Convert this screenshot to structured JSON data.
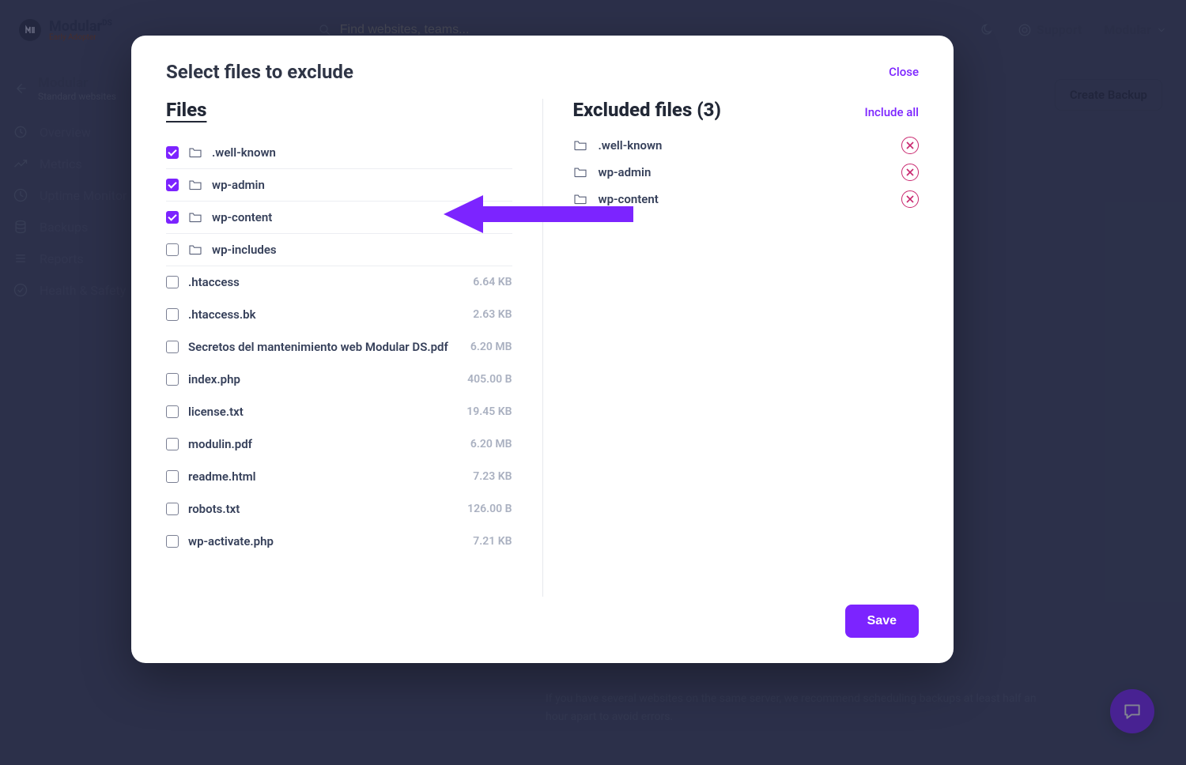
{
  "brand": {
    "name": "Modular",
    "suffix": "DS",
    "badge": "Early Adopter"
  },
  "search": {
    "placeholder": "Find websites, teams..."
  },
  "topbar": {
    "support": "Support",
    "user": "Modular"
  },
  "site": {
    "name": "Modular",
    "sub": "Standard websites"
  },
  "nav": {
    "items": [
      "Overview",
      "Metrics",
      "Uptime Monitor",
      "Backups",
      "Reports",
      "Health & Safety"
    ]
  },
  "buttons": {
    "create_backup": "Create Backup",
    "save": "Save"
  },
  "modal": {
    "title": "Select files to exclude",
    "close": "Close",
    "files_title": "Files",
    "excluded_title": "Excluded files (3)",
    "include_all": "Include all"
  },
  "files": [
    {
      "name": ".well-known",
      "folder": true,
      "checked": true,
      "size": ""
    },
    {
      "name": "wp-admin",
      "folder": true,
      "checked": true,
      "size": ""
    },
    {
      "name": "wp-content",
      "folder": true,
      "checked": true,
      "size": ""
    },
    {
      "name": "wp-includes",
      "folder": true,
      "checked": false,
      "size": ""
    },
    {
      "name": ".htaccess",
      "folder": false,
      "checked": false,
      "size": "6.64 KB"
    },
    {
      "name": ".htaccess.bk",
      "folder": false,
      "checked": false,
      "size": "2.63 KB"
    },
    {
      "name": "Secretos del mantenimiento web Modular DS.pdf",
      "folder": false,
      "checked": false,
      "size": "6.20 MB"
    },
    {
      "name": "index.php",
      "folder": false,
      "checked": false,
      "size": "405.00 B"
    },
    {
      "name": "license.txt",
      "folder": false,
      "checked": false,
      "size": "19.45 KB"
    },
    {
      "name": "modulin.pdf",
      "folder": false,
      "checked": false,
      "size": "6.20 MB"
    },
    {
      "name": "readme.html",
      "folder": false,
      "checked": false,
      "size": "7.23 KB"
    },
    {
      "name": "robots.txt",
      "folder": false,
      "checked": false,
      "size": "126.00 B"
    },
    {
      "name": "wp-activate.php",
      "folder": false,
      "checked": false,
      "size": "7.21 KB"
    }
  ],
  "excluded": [
    {
      "name": ".well-known"
    },
    {
      "name": "wp-admin"
    },
    {
      "name": "wp-content"
    }
  ],
  "bg_text": "If you have several websites on the same server, we recommend scheduling backups at least half an hour apart to avoid errors."
}
